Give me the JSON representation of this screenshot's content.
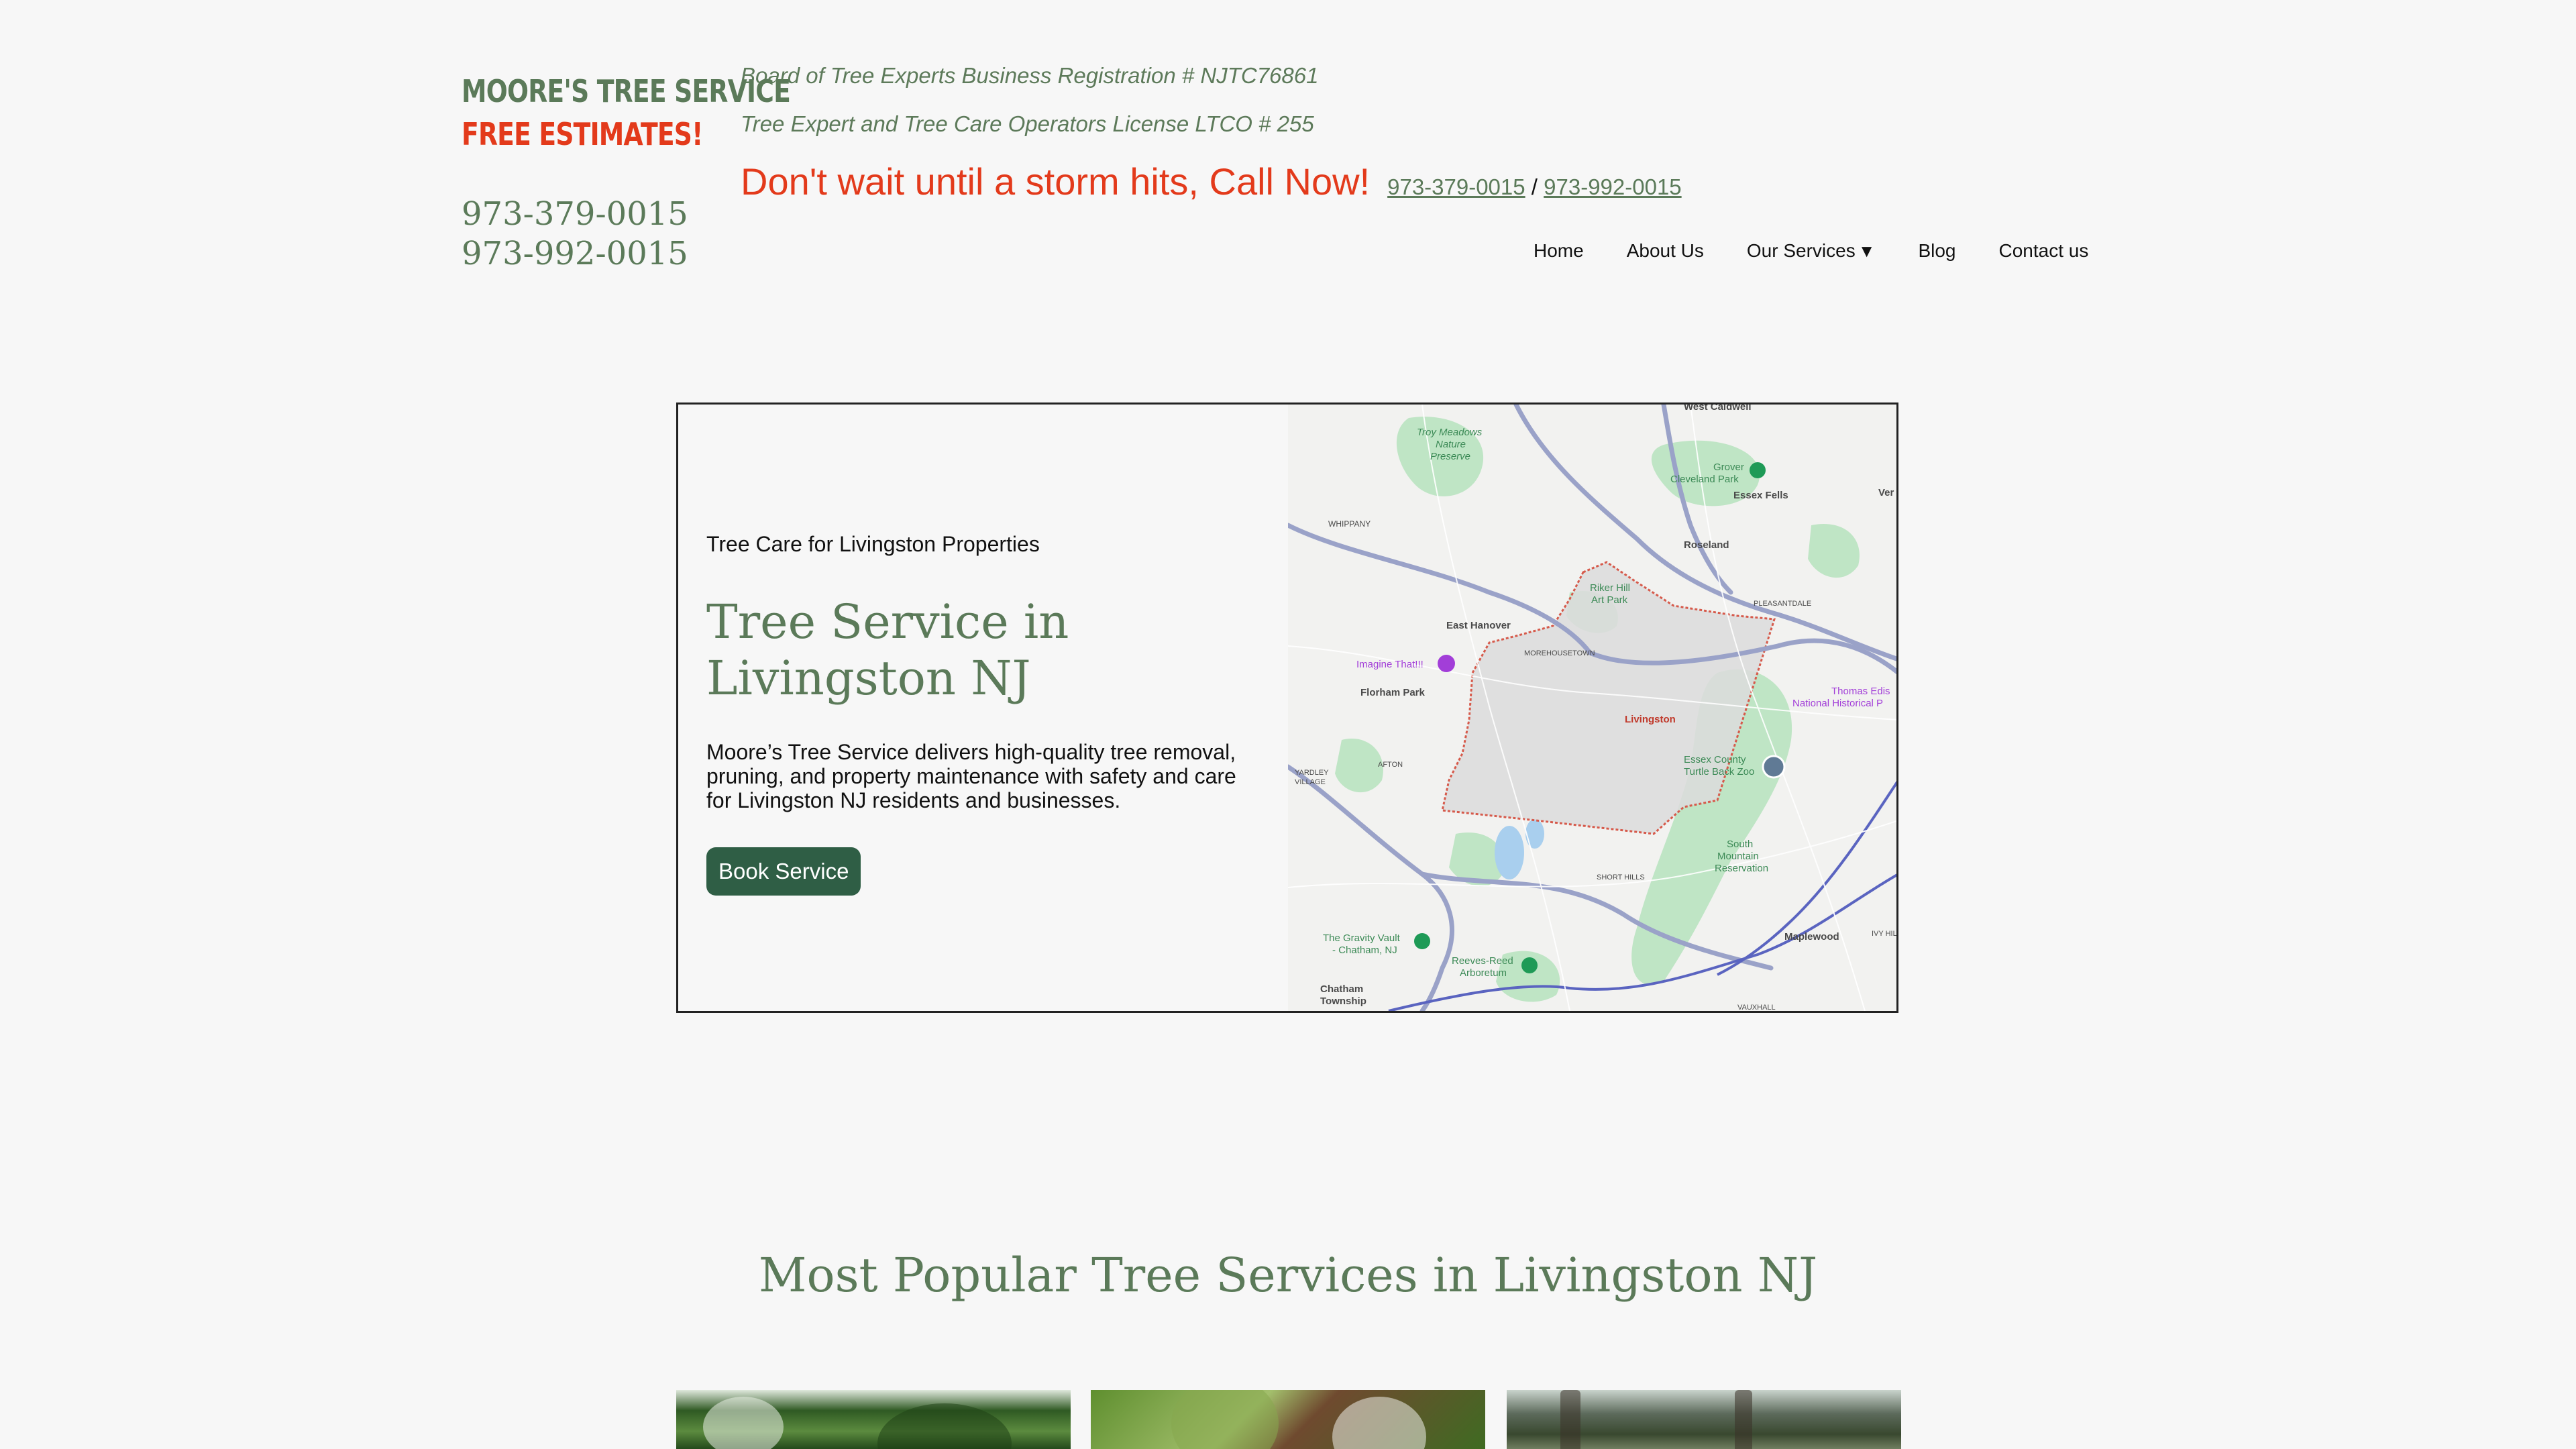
{
  "brand": {
    "name": "MOORE'S TREE SERVICE",
    "tagline": "FREE ESTIMATES!",
    "phone1": "973-379-0015",
    "phone2": "973-992-0015"
  },
  "credentials": {
    "line1": "Board of Tree Experts Business Registration # NJTC76861",
    "line2": "Tree Expert and Tree Care Operators License LTCO # 255"
  },
  "callout": {
    "text": "Don't wait until a storm hits, Call Now!",
    "phone1": "973-379-0015",
    "separator": "/",
    "phone2": "973-992-0015"
  },
  "nav": {
    "home": "Home",
    "about": "About Us",
    "services": "Our Services",
    "services_caret": "▼",
    "blog": "Blog",
    "contact": "Contact us"
  },
  "hero": {
    "eyebrow": "Tree Care for Livingston Properties",
    "title": "Tree Service in Livingston NJ",
    "description": "Moore’s Tree Service delivers high-quality tree removal, pruning, and property maintenance with safety and care for Livingston NJ residents and businesses.",
    "button": "Book Service"
  },
  "map": {
    "labels": {
      "west_caldwell": "West Caldwell",
      "troy_meadows_1": "Troy Meadows",
      "troy_meadows_2": "Nature",
      "troy_meadows_3": "Preserve",
      "grover_1": "Grover",
      "grover_2": "Cleveland Park",
      "essex_fells": "Essex Fells",
      "ver": "Ver",
      "whippany": "WHIPPANY",
      "roseland": "Roseland",
      "riker_1": "Riker Hill",
      "riker_2": "Art Park",
      "pleasantdale": "PLEASANTDALE",
      "east_hanover": "East Hanover",
      "morehousetown": "MOREHOUSETOWN",
      "imagine": "Imagine That!!!",
      "florham_park": "Florham Park",
      "livingston": "Livingston",
      "edison_1": "Thomas Edis",
      "edison_2": "National Historical P",
      "afton": "AFTON",
      "essex_zoo_1": "Essex County",
      "essex_zoo_2": "Turtle Back Zoo",
      "yardley_1": "YARDLEY",
      "yardley_2": "VILLAGE",
      "south_mountain_1": "South",
      "south_mountain_2": "Mountain",
      "south_mountain_3": "Reservation",
      "short_hills": "SHORT HILLS",
      "gravity_1": "The Gravity Vault",
      "gravity_2": "- Chatham, NJ",
      "maplewood": "Maplewood",
      "ivy_hill": "IVY HIL",
      "reeves_1": "Reeves-Reed",
      "reeves_2": "Arboretum",
      "chatham_1": "Chatham",
      "chatham_2": "Township",
      "vauxhall": "VAUXHALL"
    }
  },
  "popular": {
    "title": "Most Popular Tree Services in Livingston NJ"
  },
  "colors": {
    "brand_green": "#5b7a59",
    "accent_red": "#e33a1b",
    "button_green": "#2f5e45",
    "background": "#f7f7f7"
  },
  "icons": {
    "services_dropdown": "caret-down-icon",
    "map_pin": "map-pin-icon"
  }
}
